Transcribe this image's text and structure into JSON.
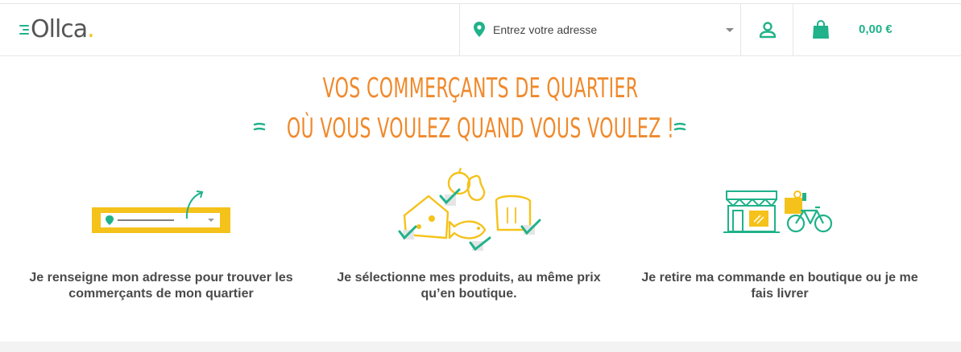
{
  "header": {
    "logo_text": "Ollca",
    "logo_dot": ".",
    "address_placeholder": "Entrez votre adresse",
    "cart_total": "0,00 €"
  },
  "hero": {
    "title_line1": "Vos commerçants de quartier",
    "title_line2": "où vous voulez quand vous voulez !"
  },
  "steps": [
    {
      "text": "Je renseigne mon adresse pour trouver les commerçants de mon quartier",
      "icon": "address-search-illustration"
    },
    {
      "text": "Je sélectionne mes produits, au même prix qu’en boutique.",
      "icon": "products-selection-illustration"
    },
    {
      "text": "Je retire ma commande en boutique ou je me fais livrer",
      "icon": "shop-bike-illustration"
    }
  ],
  "colors": {
    "accent_green": "#20b28a",
    "accent_orange": "#f0892b",
    "accent_yellow": "#f5c21b"
  }
}
